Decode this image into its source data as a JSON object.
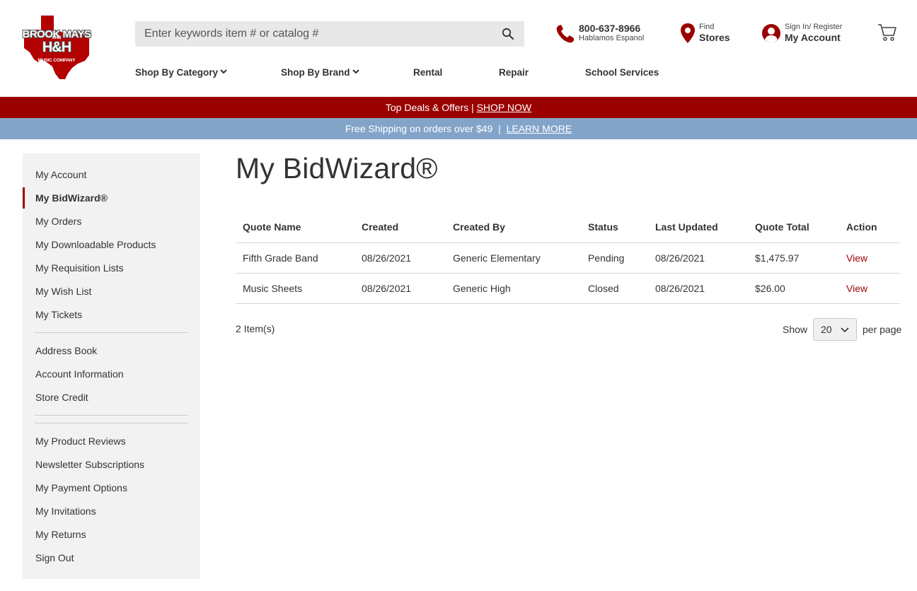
{
  "logo": {
    "line1": "BROOK MAYS",
    "line2": "AND",
    "line3": "H&H",
    "line4": "MUSIC COMPANY"
  },
  "search": {
    "placeholder": "Enter keywords item # or catalog #"
  },
  "phone": {
    "number": "800-637-8966",
    "sub": "Hablamos Espanol"
  },
  "stores": {
    "small": "Find",
    "big": "Stores"
  },
  "account": {
    "small": "Sign In/ Register",
    "big": "My Account"
  },
  "nav": {
    "category": "Shop By Category",
    "brand": "Shop By Brand",
    "rental": "Rental",
    "repair": "Repair",
    "school": "School Services"
  },
  "promo_red": {
    "text": "Top Deals & Offers",
    "sep": " | ",
    "link": "SHOP NOW"
  },
  "promo_blue": {
    "text": "Free Shipping on orders over $49",
    "sep": "  |  ",
    "link": "LEARN MORE"
  },
  "sidebar": {
    "items": [
      "My Account",
      "My BidWizard®",
      "My Orders",
      "My Downloadable Products",
      "My Requisition Lists",
      "My Wish List",
      "My Tickets",
      "Address Book",
      "Account Information",
      "Store Credit",
      "My Product Reviews",
      "Newsletter Subscriptions",
      "My Payment Options",
      "My Invitations",
      "My Returns",
      "Sign Out"
    ],
    "active_index": 1
  },
  "page_title": "My BidWizard®",
  "table": {
    "headers": [
      "Quote Name",
      "Created",
      "Created By",
      "Status",
      "Last Updated",
      "Quote Total",
      "Action"
    ],
    "rows": [
      [
        "Fifth Grade Band",
        "08/26/2021",
        "Generic Elementary",
        "Pending",
        "08/26/2021",
        "$1,475.97",
        "View"
      ],
      [
        "Music Sheets",
        "08/26/2021",
        "Generic High",
        "Closed",
        "08/26/2021",
        "$26.00",
        "View"
      ]
    ]
  },
  "pager": {
    "count": "2 Item(s)",
    "show": "Show",
    "value": "20",
    "per_page": "per page"
  },
  "colors": {
    "brand_red": "#9b0000",
    "banner_blue": "#83a4c9",
    "sidebar_bg": "#f2f2f2"
  }
}
